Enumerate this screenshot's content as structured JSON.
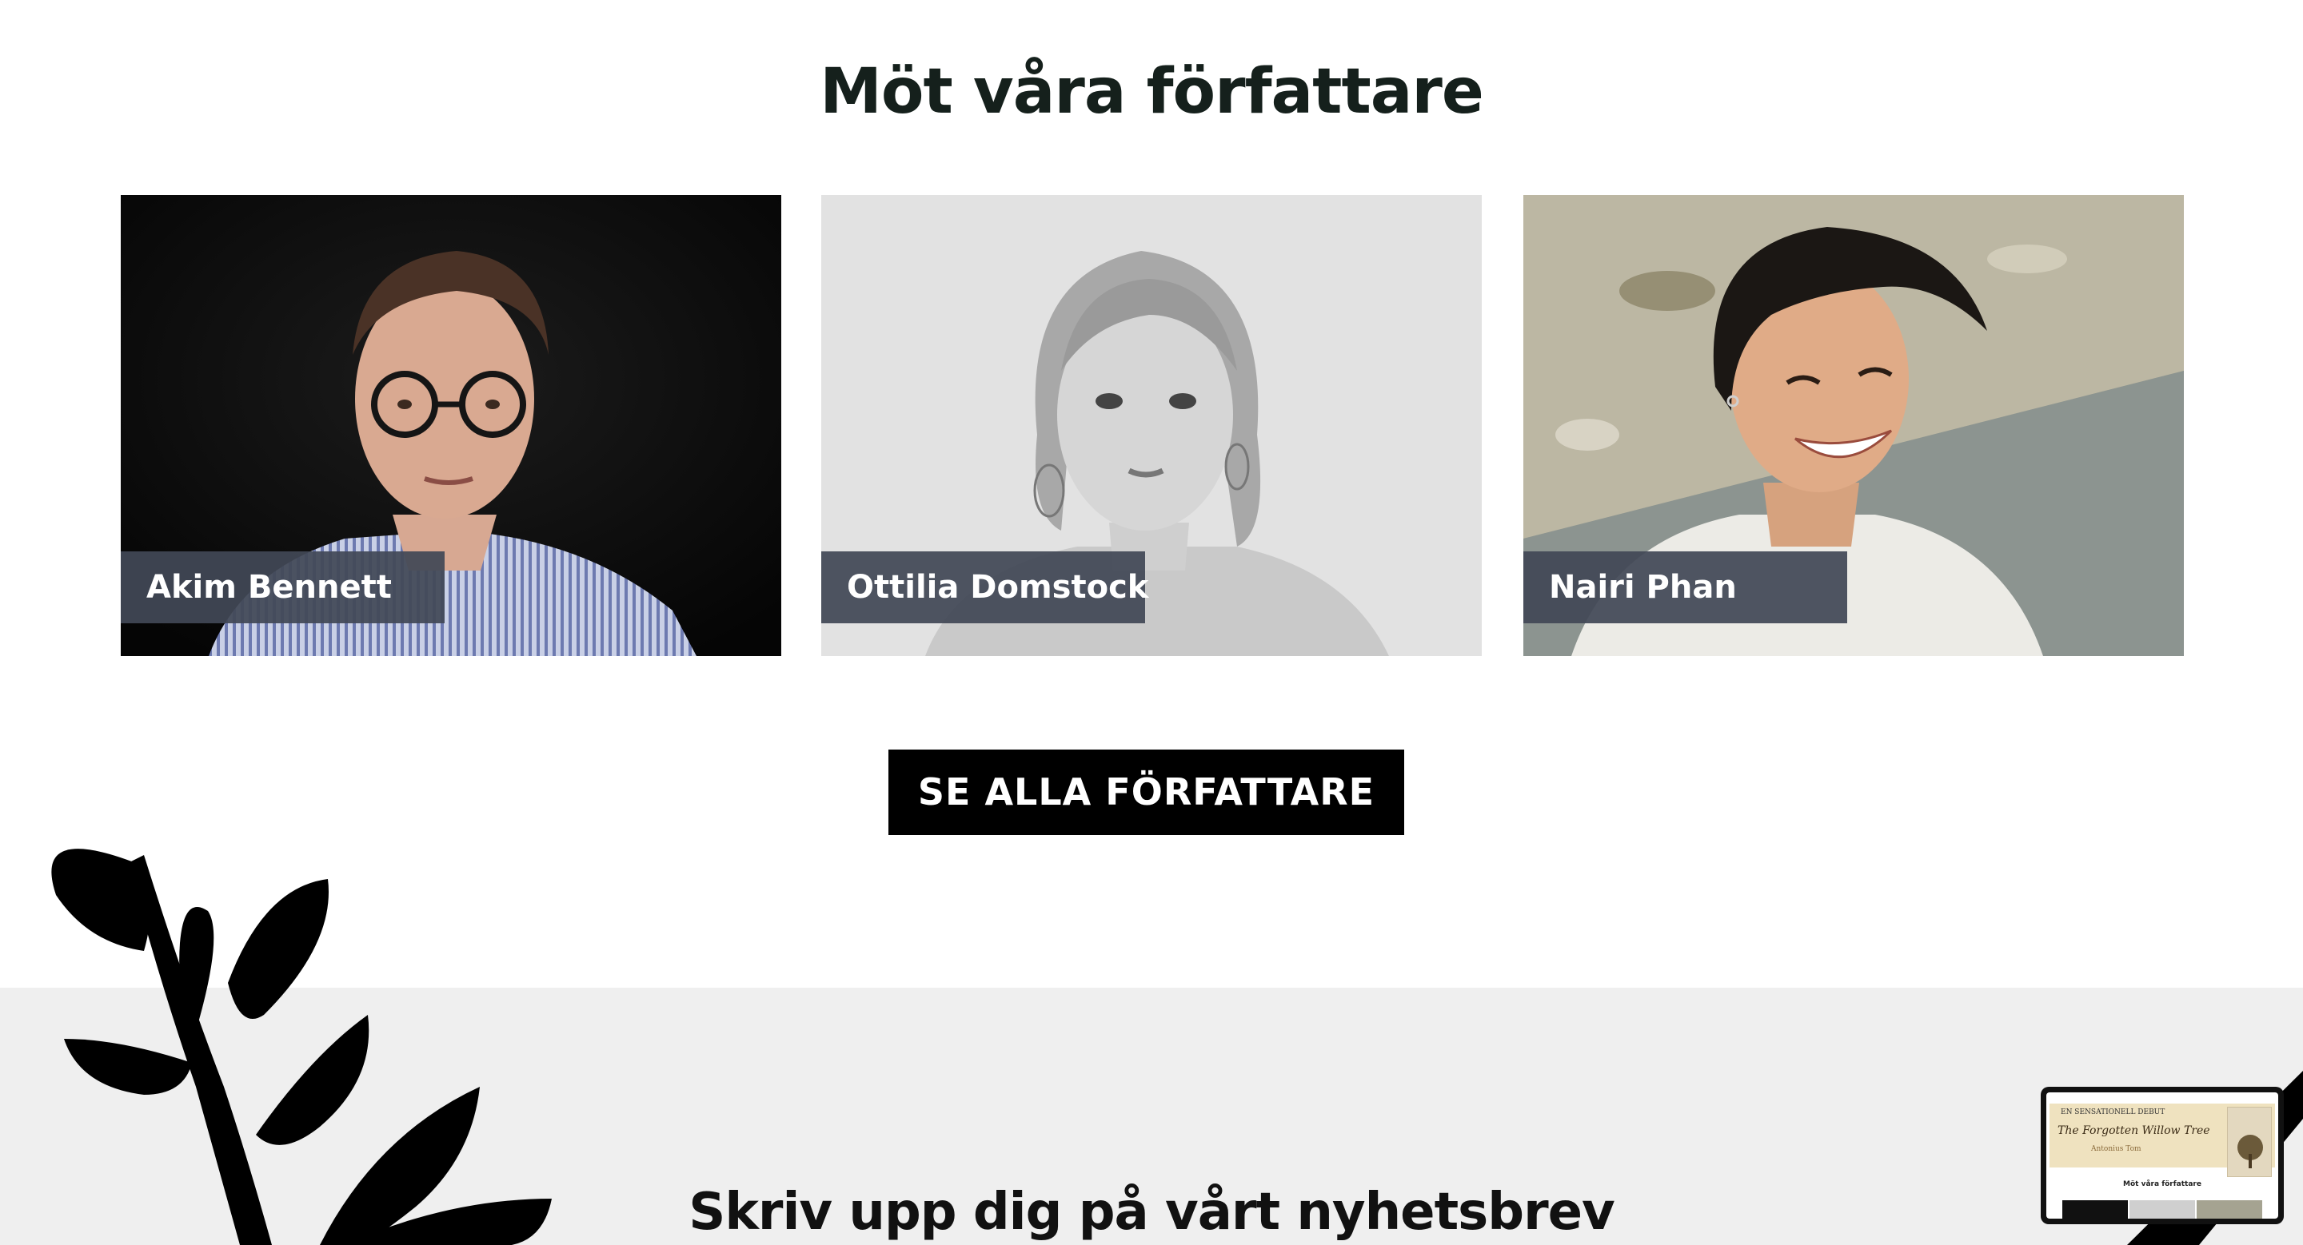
{
  "authors": {
    "title": "Möt våra författare",
    "items": [
      {
        "name": "Akim Bennett"
      },
      {
        "name": "Ottilia Domstock"
      },
      {
        "name": "Nairi Phan"
      }
    ],
    "see_all_label": "SE ALLA FÖRFATTARE"
  },
  "newsletter": {
    "title": "Skriv upp dig på vårt nyhetsbrev"
  },
  "preview": {
    "hero_label": "EN SENSATIONELL DEBUT",
    "hero_title": "The Forgotten Willow Tree",
    "hero_author": "Antonius Tom",
    "heading": "Möt våra författare"
  }
}
